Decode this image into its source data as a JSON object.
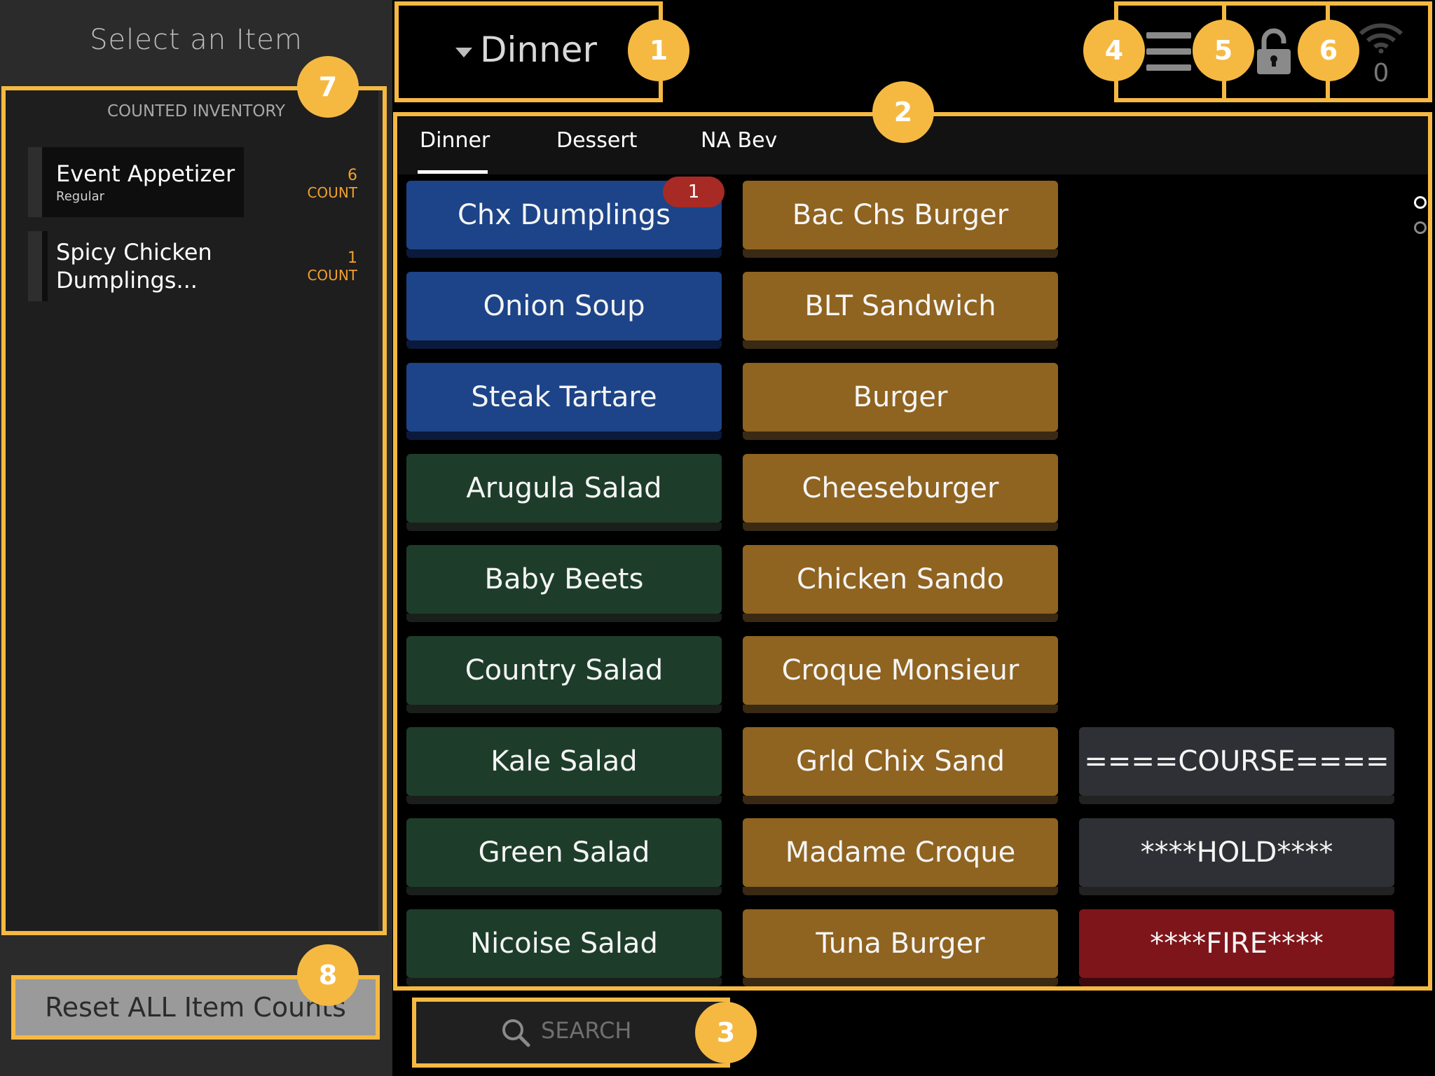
{
  "left_panel": {
    "title": "Select an Item",
    "inventory_header": "COUNTED INVENTORY",
    "items": [
      {
        "name": "Event Appetizer",
        "subtitle": "Regular",
        "count": "6",
        "count_label": "COUNT"
      },
      {
        "name_line1": "Spicy Chicken",
        "name_line2": "Dumplings...",
        "count": "1",
        "count_label": "COUNT"
      }
    ],
    "reset_label": "Reset ALL Item Counts"
  },
  "header": {
    "menu_title": "Dinner",
    "offline_count": "0",
    "icons": [
      "chevron-down-icon",
      "hamburger-menu-icon",
      "lock-icon",
      "wifi-icon"
    ]
  },
  "tabs": [
    {
      "label": "Dinner",
      "active": true
    },
    {
      "label": "Dessert",
      "active": false
    },
    {
      "label": "NA Bev",
      "active": false
    }
  ],
  "grid": {
    "col1": [
      {
        "label": "Chx Dumplings",
        "color": "#1d4488",
        "badge": "1"
      },
      {
        "label": "Onion Soup",
        "color": "#1d4488"
      },
      {
        "label": "Steak Tartare",
        "color": "#1d4488"
      },
      {
        "label": "Arugula Salad",
        "color": "#1d3d2a"
      },
      {
        "label": "Baby Beets",
        "color": "#1d3d2a"
      },
      {
        "label": "Country Salad",
        "color": "#1d3d2a"
      },
      {
        "label": "Kale Salad",
        "color": "#1d3d2a"
      },
      {
        "label": "Green Salad",
        "color": "#1d3d2a"
      },
      {
        "label": "Nicoise Salad",
        "color": "#1d3d2a"
      }
    ],
    "col2": [
      {
        "label": "Bac Chs Burger",
        "color": "#8f6320"
      },
      {
        "label": "BLT Sandwich",
        "color": "#8f6320"
      },
      {
        "label": "Burger",
        "color": "#8f6320"
      },
      {
        "label": "Cheeseburger",
        "color": "#8f6320"
      },
      {
        "label": "Chicken Sando",
        "color": "#8f6320"
      },
      {
        "label": "Croque Monsieur",
        "color": "#8f6320"
      },
      {
        "label": "Grld Chix Sand",
        "color": "#8f6320"
      },
      {
        "label": "Madame Croque",
        "color": "#8f6320"
      },
      {
        "label": "Tuna Burger",
        "color": "#8f6320"
      }
    ],
    "col3": [
      {
        "label": "====COURSE====",
        "color": "#2f3035"
      },
      {
        "label": "****HOLD****",
        "color": "#2f3035"
      },
      {
        "label": "****FIRE****",
        "color": "#7e151a"
      }
    ]
  },
  "search": {
    "placeholder": "SEARCH"
  },
  "callouts": [
    "1",
    "2",
    "3",
    "4",
    "5",
    "6",
    "7",
    "8"
  ],
  "accent_color": "#f5b942"
}
